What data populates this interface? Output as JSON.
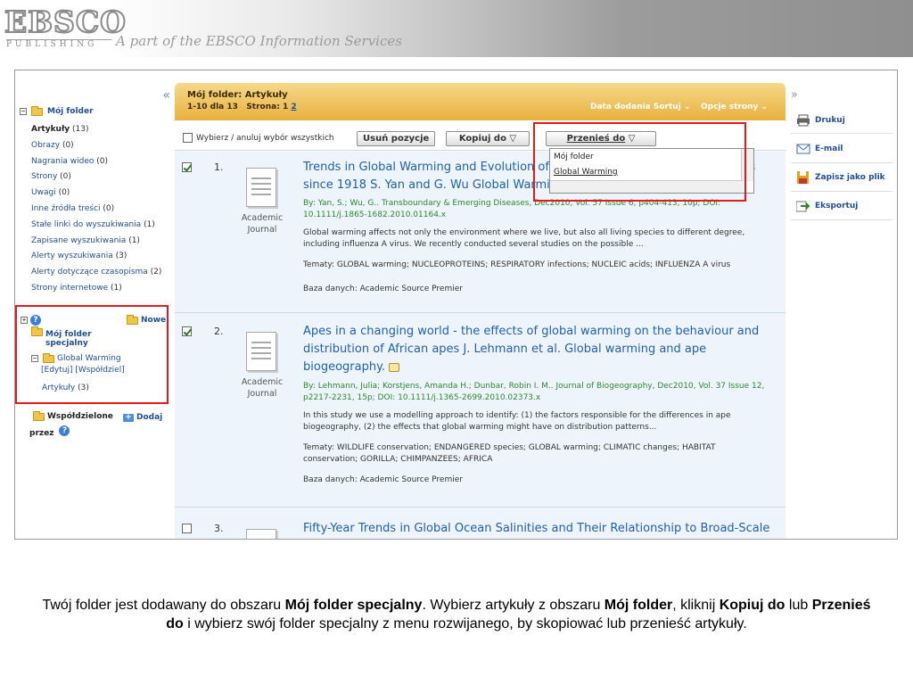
{
  "banner": {
    "logo_main": "EBSCO",
    "logo_sub": "PUBLISHING",
    "tagline": "A part of the EBSCO Information Services"
  },
  "left_panel": {
    "collapse": "«",
    "folder_title": "Mój folder",
    "items": [
      {
        "label": "Artykuły",
        "count": "(13)",
        "bold": true
      },
      {
        "label": "Obrazy",
        "count": "(0)"
      },
      {
        "label": "Nagrania wideo",
        "count": "(0)"
      },
      {
        "label": "Strony",
        "count": "(0)"
      },
      {
        "label": "Uwagi",
        "count": "(0)"
      },
      {
        "label": "Inne źródła treści",
        "count": "(0)"
      },
      {
        "label": "Stałe linki do wyszukiwania",
        "count": "(1)"
      },
      {
        "label": "Zapisane wyszukiwania",
        "count": "(1)"
      },
      {
        "label": "Alerty wyszukiwania",
        "count": "(3)"
      },
      {
        "label": "Alerty dotyczące czasopisma",
        "count": "(2)"
      },
      {
        "label": "Strony internetowe",
        "count": "(1)"
      }
    ],
    "special": {
      "new_label": "Nowe",
      "title_line1": "Mój folder",
      "title_line2": "specjalny",
      "sub_folder": "Global Warming",
      "edit": "[Edytuj]",
      "share": "[Współdziel]",
      "articles": "Artykuły",
      "articles_count": "(3)"
    },
    "shared": {
      "title": "Współdzielone",
      "by": "przez",
      "add": "Dodaj"
    }
  },
  "header": {
    "title": "Mój folder: Artykuły",
    "range": "1-10 dla 13",
    "page_label": "Strona:",
    "page_current": "1",
    "page_next": "2",
    "sort": "Data dodania Sortuj ⌄",
    "options": "Opcje strony ⌄"
  },
  "toolbar": {
    "select_all": "Wybierz / anuluj wybór wszystkich",
    "delete": "Usuń pozycje",
    "copy": "Kopiuj do ▽",
    "move": "Przenieś do",
    "move_arrow": "▽"
  },
  "dropdown": {
    "options": [
      "Mój folder",
      "Global Warming"
    ]
  },
  "results": [
    {
      "num": "1.",
      "checked": true,
      "type_line1": "Academic",
      "type_line2": "Journal",
      "title_line1": "Trends in Global Warming and Evolution of",
      "title_tail": "ruses",
      "title_line2": "since 1918 S. Yan and G. Wu Global Warmin",
      "by": "By: Yan, S.; Wu, G.. Transboundary & Emerging Diseases, Dec2010, Vol. 57 Issue 6, p404-413, 10p; DOI: 10.1111/j.1865-1682.2010.01164.x",
      "abstract": "Global warming affects not only the environment where we live, but also all living species to different degree, including influenza A virus. We recently conducted several studies on the possible ...",
      "subjects": "Tematy: GLOBAL warming; NUCLEOPROTEINS; RESPIRATORY infections; NUCLEIC acids; INFLUENZA A virus",
      "db": "Baza danych: Academic Source Premier"
    },
    {
      "num": "2.",
      "checked": true,
      "type_line1": "Academic",
      "type_line2": "Journal",
      "title_line1": "Apes in a changing world - the effects of global warming on the behaviour and",
      "title_line2": "distribution of African apes J. Lehmann et al. Global warming and ape",
      "title_line3": "biogeography.",
      "by": "By: Lehmann, Julia; Korstjens, Amanda H.; Dunbar, Robin I. M.. Journal of Biogeography, Dec2010, Vol. 37 Issue 12, p2217-2231, 15p; DOI: 10.1111/j.1365-2699.2010.02373.x",
      "abstract": "In this study we use a modelling approach to identify: (1) the factors responsible for the differences in ape biogeography, (2) the effects that global warming might have on distribution patterns...",
      "subjects": "Tematy: WILDLIFE conservation; ENDANGERED species; GLOBAL warming; CLIMATIC changes; HABITAT conservation; GORILLA; CHIMPANZEES; AFRICA",
      "db": "Baza danych: Academic Source Premier"
    },
    {
      "num": "3.",
      "checked": false,
      "title_line1": "Fifty-Year Trends in Global Ocean Salinities and Their Relationship to Broad-Scale"
    }
  ],
  "right_panel": {
    "collapse": "»",
    "actions": [
      "Drukuj",
      "E-mail",
      "Zapisz jako plik",
      "Eksportuj"
    ]
  },
  "caption": {
    "p1": "Twój folder jest dodawany do obszaru ",
    "b1": "Mój folder specjalny",
    "p2": ". Wybierz artykuły z obszaru ",
    "b2": "Mój folder",
    "p3": ", kliknij ",
    "b3": "Kopiuj do",
    "p4": " lub ",
    "b4": "Przenieś do",
    "p5": " i wybierz swój folder specjalny z menu rozwijanego, by skopiować lub przenieść artykuły."
  },
  "colors": {
    "highlight": "#e31b1b",
    "link": "#1f4f9a",
    "header_gold": "#e8b13e"
  }
}
